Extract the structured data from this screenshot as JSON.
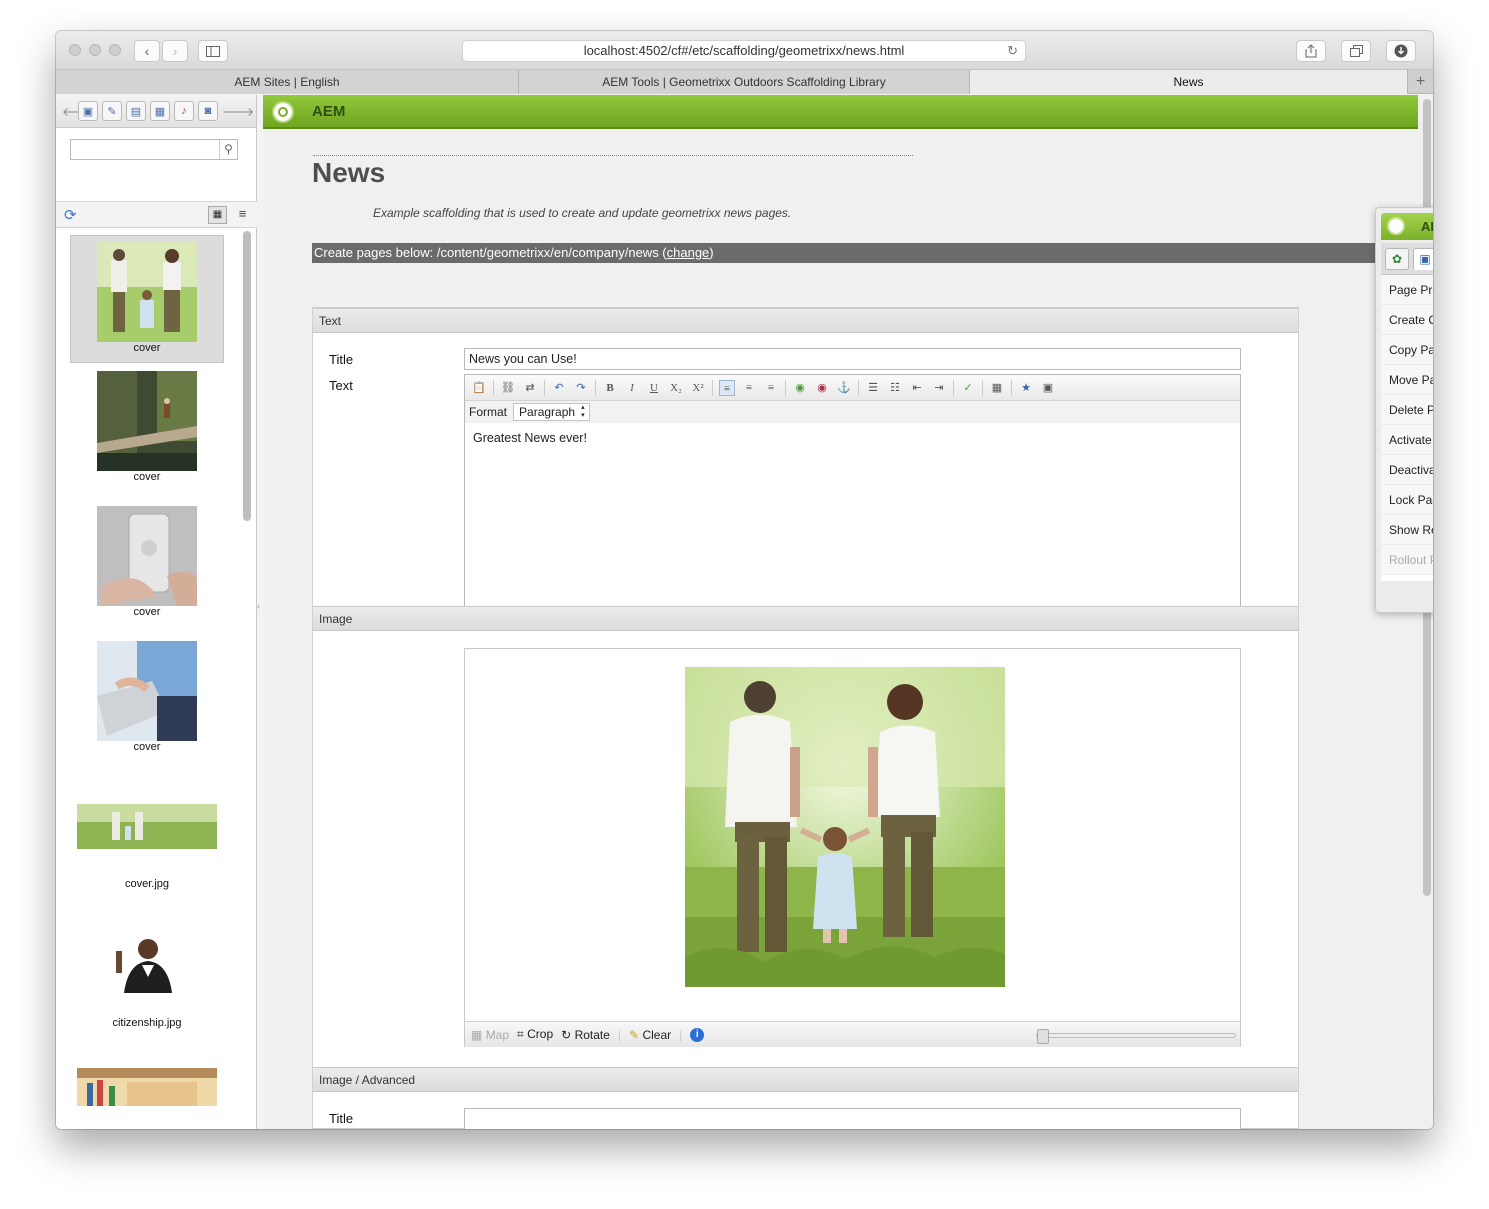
{
  "browser": {
    "url": "localhost:4502/cf#/etc/scaffolding/geometrixx/news.html",
    "tabs": [
      {
        "label": "AEM Sites | English"
      },
      {
        "label": "AEM Tools | Geometrixx Outdoors Scaffolding Library"
      },
      {
        "label": "News"
      }
    ]
  },
  "app": {
    "name": "AEM"
  },
  "sidebar": {
    "assets": [
      {
        "caption": "cover"
      },
      {
        "caption": "cover"
      },
      {
        "caption": "cover"
      },
      {
        "caption": "cover"
      },
      {
        "caption": "cover.jpg"
      },
      {
        "caption": "citizenship.jpg"
      }
    ]
  },
  "page": {
    "title": "News",
    "description": "Example scaffolding that is used to create and update geometrixx news pages.",
    "create_prefix": "Create pages below: /content/geometrixx/en/company/news (",
    "change_link": "change",
    "create_suffix": ")"
  },
  "form": {
    "text_section": "Text",
    "title_label": "Title",
    "title_value": "News you can Use!",
    "text_label": "Text",
    "format_label": "Format",
    "paragraph_option": "Paragraph",
    "text_body": "Greatest News ever!",
    "image_section": "Image",
    "image_tools": {
      "map": "Map",
      "crop": "Crop",
      "rotate": "Rotate",
      "clear": "Clear"
    },
    "advanced_section": "Image / Advanced",
    "advanced_title_label": "Title"
  },
  "sidekick": {
    "title": "AEM",
    "items": [
      {
        "label": "Page Properties..."
      },
      {
        "label": "Create Child Page"
      },
      {
        "label": "Copy Page"
      },
      {
        "label": "Move Page"
      },
      {
        "label": "Delete Page"
      },
      {
        "label": "Activate Page"
      },
      {
        "label": "Deactivate Page"
      },
      {
        "label": "Lock Page"
      },
      {
        "label": "Show References..."
      },
      {
        "label": "Rollout Page"
      }
    ]
  }
}
